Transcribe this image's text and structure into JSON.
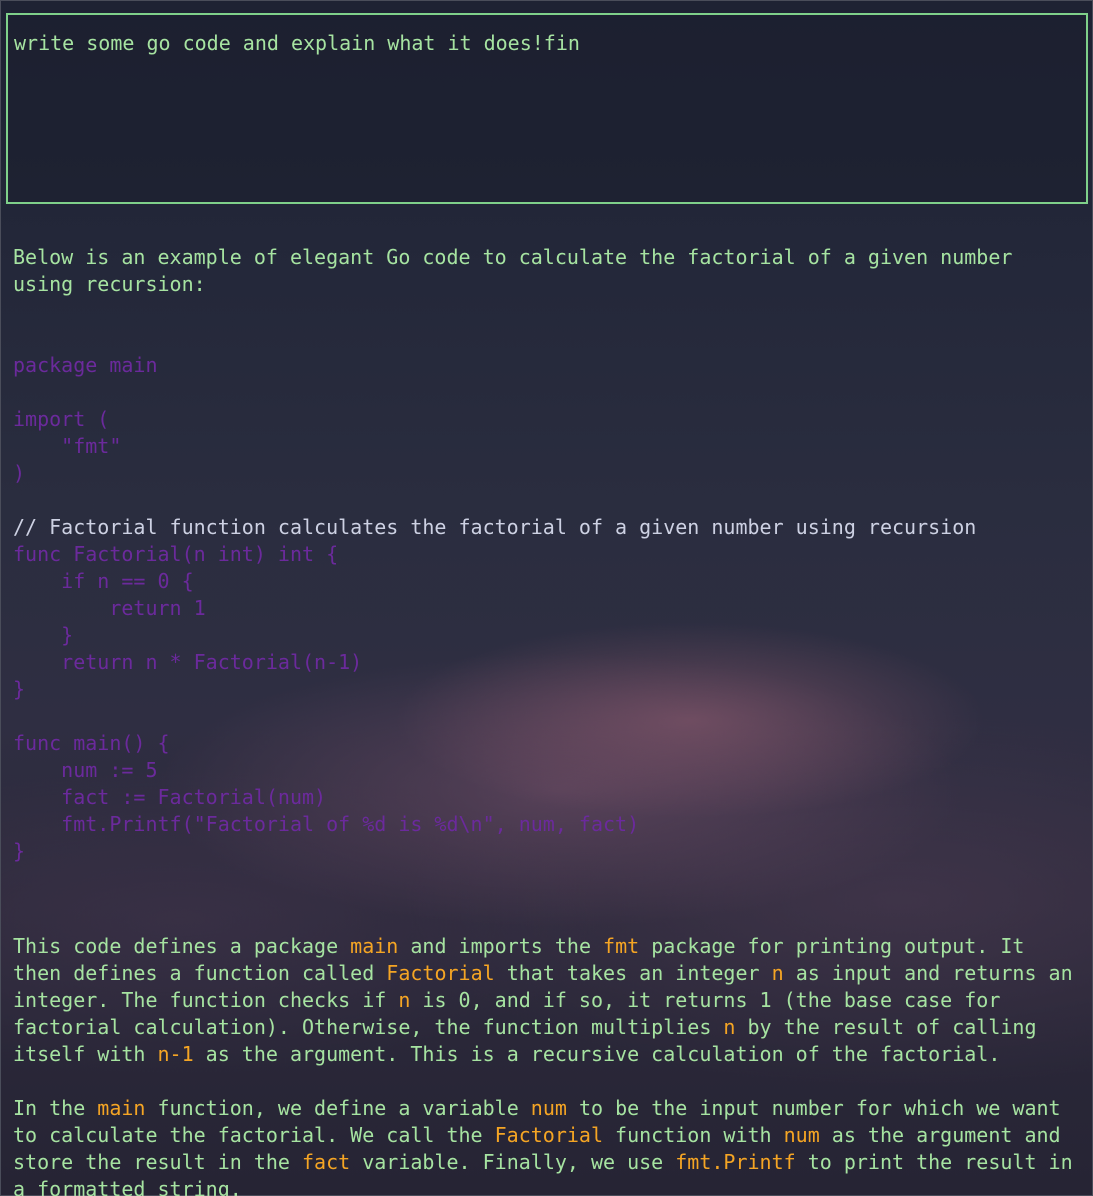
{
  "prompt": {
    "value": "write some go code and explain what it does!fin"
  },
  "response": {
    "intro": "Below is an example of elegant Go code to calculate the factorial of a given number using recursion:",
    "code_lines": [
      "package main",
      "",
      "import (",
      "    \"fmt\"",
      ")",
      "",
      "// Factorial function calculates the factorial of a given number using recursion",
      "func Factorial(n int) int {",
      "    if n == 0 {",
      "        return 1",
      "    }",
      "    return n * Factorial(n-1)",
      "}",
      "",
      "func main() {",
      "    num := 5",
      "    fact := Factorial(num)",
      "    fmt.Printf(\"Factorial of %d is %d\\n\", num, fact)",
      "}"
    ],
    "para1": [
      {
        "t": "This code defines a package ",
        "hl": false
      },
      {
        "t": "main",
        "hl": true
      },
      {
        "t": " and imports the ",
        "hl": false
      },
      {
        "t": "fmt",
        "hl": true
      },
      {
        "t": " package for printing output. It then defines a function called ",
        "hl": false
      },
      {
        "t": "Factorial",
        "hl": true
      },
      {
        "t": " that takes an integer ",
        "hl": false
      },
      {
        "t": "n",
        "hl": true
      },
      {
        "t": " as input and returns an integer. The function checks if ",
        "hl": false
      },
      {
        "t": "n",
        "hl": true
      },
      {
        "t": " is 0, and if so, it returns 1 (the base case for factorial calculation). Otherwise, the function multiplies ",
        "hl": false
      },
      {
        "t": "n",
        "hl": true
      },
      {
        "t": " by the result of calling itself with ",
        "hl": false
      },
      {
        "t": "n-1",
        "hl": true
      },
      {
        "t": " as the argument. This is a recursive calculation of the factorial.",
        "hl": false
      }
    ],
    "para2": [
      {
        "t": "In the ",
        "hl": false
      },
      {
        "t": "main",
        "hl": true
      },
      {
        "t": " function, we define a variable ",
        "hl": false
      },
      {
        "t": "num",
        "hl": true
      },
      {
        "t": " to be the input number for which we want to calculate the factorial. We call the ",
        "hl": false
      },
      {
        "t": "Factorial",
        "hl": true
      },
      {
        "t": " function with ",
        "hl": false
      },
      {
        "t": "num",
        "hl": true
      },
      {
        "t": " as the argument and store the result in the ",
        "hl": false
      },
      {
        "t": "fact",
        "hl": true
      },
      {
        "t": " variable. Finally, we use ",
        "hl": false
      },
      {
        "t": "fmt.Printf",
        "hl": true
      },
      {
        "t": " to print the result in a formatted string.",
        "hl": false
      }
    ]
  },
  "colors": {
    "text": "#a6e3a1",
    "border": "#7fd08a",
    "code": "#6b2a9c",
    "comment": "#cdd1e3",
    "highlight": "#f5a524"
  }
}
